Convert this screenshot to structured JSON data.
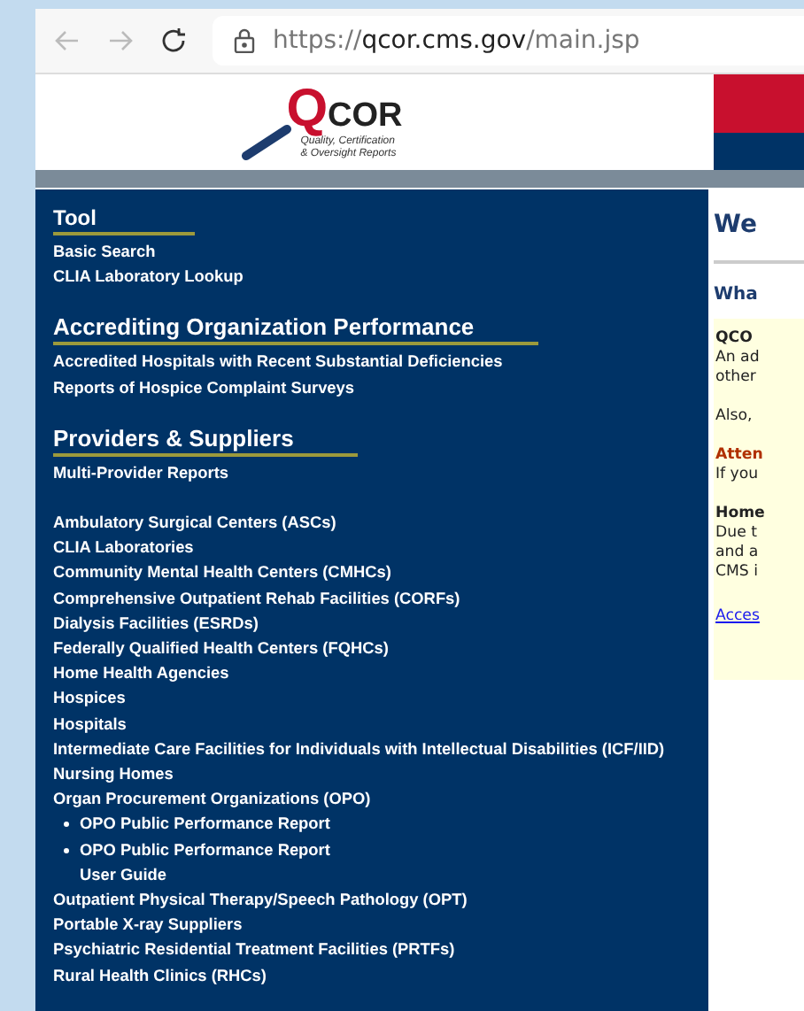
{
  "browser": {
    "back_disabled": true,
    "forward_disabled": true,
    "url": {
      "scheme": "https://",
      "host": "qcor.cms.gov",
      "path": "/main.jsp"
    }
  },
  "logo": {
    "letter": "Q",
    "word": "COR",
    "tagline": [
      "Quality, Certification",
      "& Oversight Reports"
    ]
  },
  "nav": [
    {
      "heading": "Tool",
      "groups": [
        [
          {
            "label": "Basic Search"
          },
          {
            "label": "CLIA Laboratory Lookup"
          }
        ]
      ]
    },
    {
      "heading": "Accrediting Organization Performance",
      "groups": [
        [
          {
            "label": "Accredited Hospitals with Recent Substantial Deficiencies"
          },
          {
            "label": "Reports of Hospice Complaint Surveys"
          }
        ]
      ]
    },
    {
      "heading": "Providers & Suppliers",
      "groups": [
        [
          {
            "label": "Multi-Provider Reports"
          }
        ],
        [
          {
            "label": "Ambulatory Surgical Centers (ASCs)"
          },
          {
            "label": "CLIA Laboratories"
          },
          {
            "label": "Community Mental Health Centers (CMHCs)"
          },
          {
            "label": "Comprehensive Outpatient Rehab Facilities (CORFs)"
          },
          {
            "label": "Dialysis Facilities (ESRDs)"
          },
          {
            "label": "Federally Qualified Health Centers (FQHCs)"
          },
          {
            "label": "Home Health Agencies"
          },
          {
            "label": "Hospices"
          },
          {
            "label": "Hospitals"
          },
          {
            "label": "Intermediate Care Facilities for Individuals with Intellectual Disabilities (ICF/IID)"
          },
          {
            "label": "Nursing Homes"
          },
          {
            "label": "Organ Procurement Organizations (OPO)",
            "children": [
              {
                "label": "OPO Public Performance Report"
              },
              {
                "label": "OPO Public Performance Report\nUser Guide"
              }
            ]
          },
          {
            "label": "Outpatient Physical Therapy/Speech Pathology (OPT)"
          },
          {
            "label": "Portable X-ray Suppliers"
          },
          {
            "label": "Psychiatric Residential Treatment Facilities (PRTFs)"
          },
          {
            "label": "Rural Health Clinics (RHCs)"
          }
        ]
      ]
    }
  ],
  "content": {
    "title": "We",
    "subtitle": "Wha",
    "paragraphs": [
      [
        {
          "kind": "heading",
          "text": "QCO"
        },
        {
          "kind": "text",
          "text": "An ad"
        },
        {
          "kind": "text",
          "text": "other"
        }
      ],
      [
        {
          "kind": "text",
          "text": "Also,"
        }
      ],
      [
        {
          "kind": "alert",
          "text": "Atten"
        },
        {
          "kind": "text",
          "text": "If you"
        }
      ],
      [
        {
          "kind": "heading",
          "text": "Home"
        },
        {
          "kind": "text",
          "text": "Due t"
        },
        {
          "kind": "text",
          "text": "and a"
        },
        {
          "kind": "text",
          "text": "CMS i"
        }
      ]
    ],
    "link": "Acces"
  }
}
